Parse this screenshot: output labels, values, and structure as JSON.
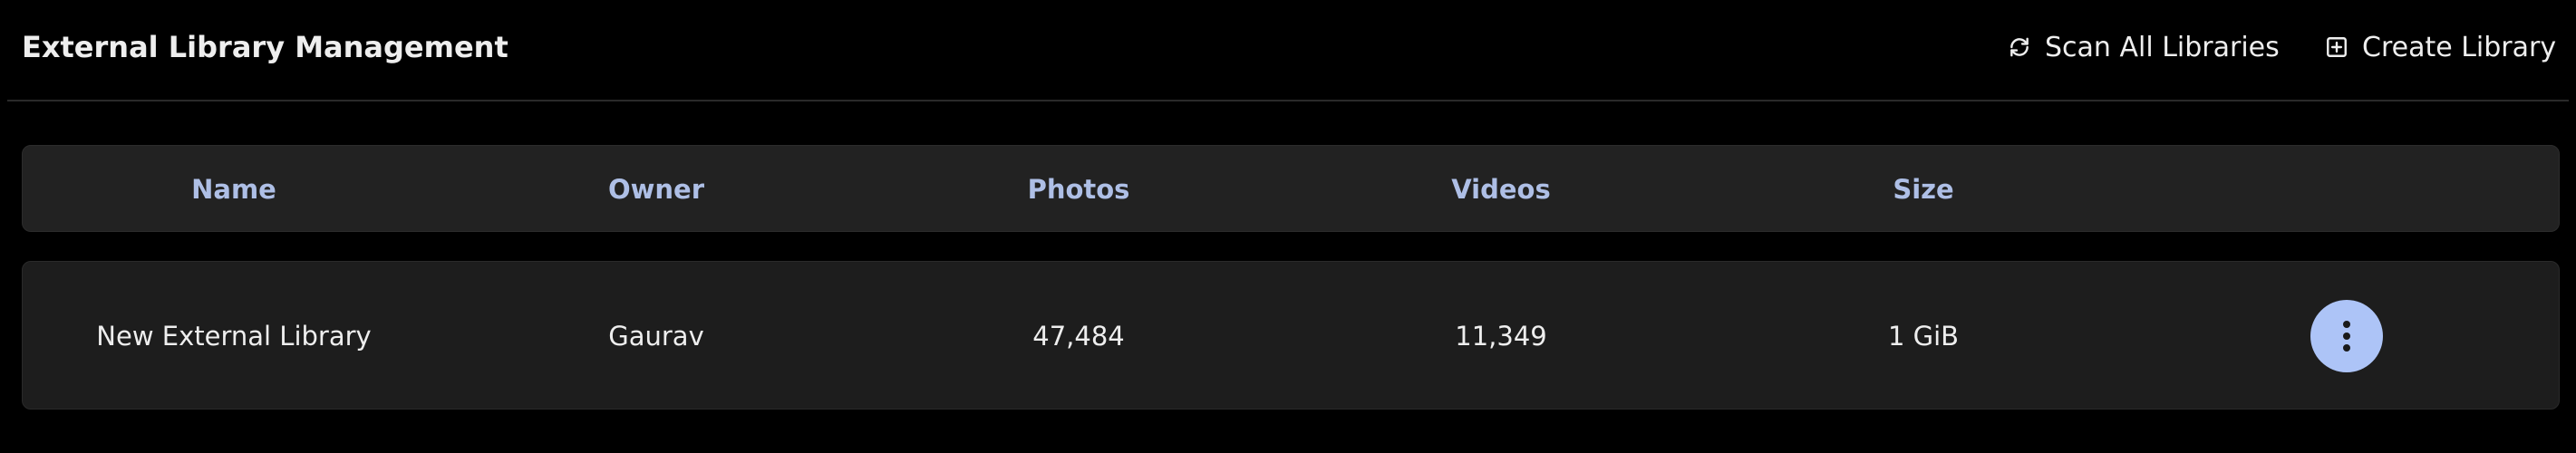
{
  "header": {
    "title": "External Library Management",
    "scan_label": "Scan All Libraries",
    "create_label": "Create Library"
  },
  "table": {
    "columns": [
      "Name",
      "Owner",
      "Photos",
      "Videos",
      "Size"
    ],
    "rows": [
      {
        "name": "New External Library",
        "owner": "Gaurav",
        "photos": "47,484",
        "videos": "11,349",
        "size": "1 GiB"
      }
    ]
  },
  "icons": {
    "scan": "refresh-icon",
    "create": "plus-square-icon",
    "row_menu": "vertical-dots-icon"
  },
  "colors": {
    "background": "#000000",
    "header_text": "#aebfe6",
    "accent": "#adc4f7"
  }
}
